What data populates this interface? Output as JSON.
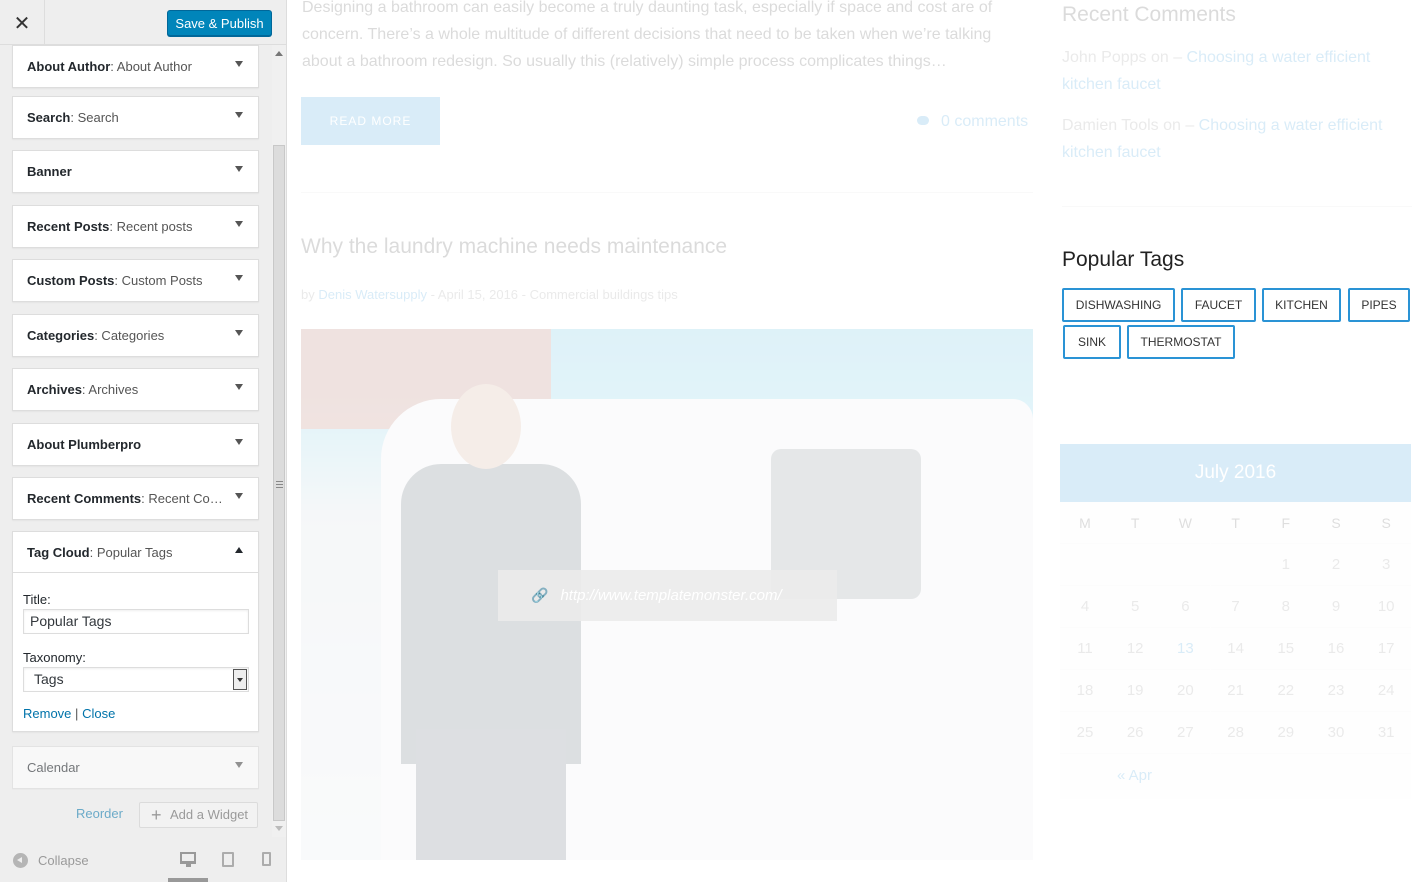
{
  "sidebar": {
    "close_label": "✕",
    "save_label": "Save & Publish",
    "widgets": [
      {
        "name": "About Author",
        "sub": ": About Author"
      },
      {
        "name": "Search",
        "sub": ": Search"
      },
      {
        "name": "Banner",
        "sub": ""
      },
      {
        "name": "Recent Posts",
        "sub": ": Recent posts"
      },
      {
        "name": "Custom Posts",
        "sub": ": Custom Posts"
      },
      {
        "name": "Categories",
        "sub": ": Categories"
      },
      {
        "name": "Archives",
        "sub": ": Archives"
      },
      {
        "name": "About Plumberpro",
        "sub": ""
      },
      {
        "name": "Recent Comments",
        "sub": ": Recent Co…"
      }
    ],
    "tag_cloud": {
      "name": "Tag Cloud",
      "sub": ": Popular Tags",
      "title_label": "Title:",
      "title_value": "Popular Tags",
      "taxonomy_label": "Taxonomy:",
      "taxonomy_value": "Tags",
      "remove_label": "Remove",
      "separator": "|",
      "close_label": "Close"
    },
    "calendar_widget": {
      "name": "Calendar"
    },
    "reorder_label": "Reorder",
    "add_widget_label": "Add a Widget",
    "collapse_label": "Collapse"
  },
  "preview": {
    "excerpt": "Designing a bathroom can easily become a truly daunting task, especially if space and cost are of concern. There’s a whole multitude of different decisions that need to be taken when we’re talking about a bathroom redesign. So usually this (relatively) simple process complicates things…",
    "read_more": "READ MORE",
    "comments": "0 comments",
    "post_title": "Why the laundry machine needs maintenance",
    "post_meta": {
      "by": "by ",
      "author": "Denis Watersupply",
      "rest": " - April 15, 2016 - Commercial buildings tips"
    },
    "image_url": "http://www.templatemonster.com/",
    "recent_comments_title": "Recent Comments",
    "recent_comments": [
      {
        "author": "John Popps",
        "on": " on – ",
        "post": "Choosing a water efficient kitchen faucet"
      },
      {
        "author": "Damien Tools",
        "on": " on – ",
        "post": "Choosing a water efficient kitchen faucet"
      }
    ],
    "popular_tags_title": "Popular Tags",
    "tags": [
      "DISHWASHING",
      "FAUCET",
      "KITCHEN",
      "PIPES",
      "SINK",
      "THERMOSTAT"
    ],
    "calendar": {
      "month": "July 2016",
      "weekdays": [
        "M",
        "T",
        "W",
        "T",
        "F",
        "S",
        "S"
      ],
      "weeks": [
        [
          "",
          "",
          "",
          "",
          "1",
          "2",
          "3"
        ],
        [
          "4",
          "5",
          "6",
          "7",
          "8",
          "9",
          "10"
        ],
        [
          "11",
          "12",
          "13",
          "14",
          "15",
          "16",
          "17"
        ],
        [
          "18",
          "19",
          "20",
          "21",
          "22",
          "23",
          "24"
        ],
        [
          "25",
          "26",
          "27",
          "28",
          "29",
          "30",
          "31"
        ]
      ],
      "today": "13",
      "prev_link": "« Apr"
    }
  },
  "colors": {
    "accent": "#2a93d5",
    "publish": "#0085ba"
  }
}
